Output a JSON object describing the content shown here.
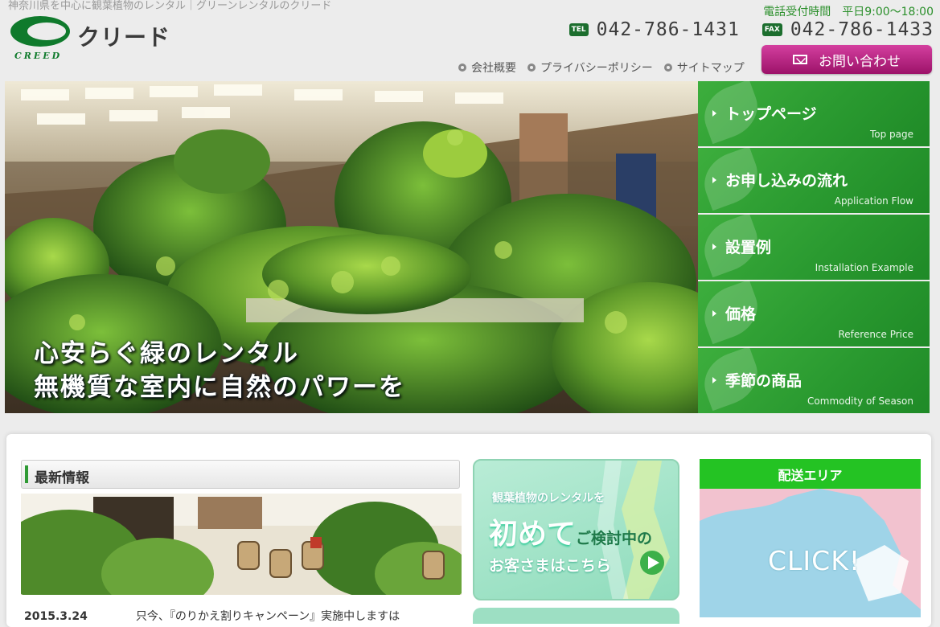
{
  "tagline": "神奈川県を中心に観葉植物のレンタル｜グリーンレンタルのクリード",
  "logo": {
    "jp": "クリード",
    "en": "CREED"
  },
  "contact": {
    "hours_label": "電話受付時間",
    "hours_value": "平日9:00〜18:00",
    "tel_tag": "TEL",
    "tel": "042-786-1431",
    "fax_tag": "FAX",
    "fax": "042-786-1433",
    "button": "お問い合わせ"
  },
  "toplinks": [
    "会社概要",
    "プライバシーポリシー",
    "サイトマップ"
  ],
  "hero": {
    "line1": "心安らぐ緑のレンタル",
    "line2": "無機質な室内に自然のパワーを"
  },
  "nav": [
    {
      "jp": "トップページ",
      "en": "Top page"
    },
    {
      "jp": "お申し込みの流れ",
      "en": "Application Flow"
    },
    {
      "jp": "設置例",
      "en": "Installation Example"
    },
    {
      "jp": "価格",
      "en": "Reference Price"
    },
    {
      "jp": "季節の商品",
      "en": "Commodity of Season"
    }
  ],
  "news": {
    "title": "最新情報",
    "date": "2015.3.24",
    "text": "只今、『のりかえ割りキャンペーン』実施中しますは"
  },
  "banner": {
    "line1": "観葉植物のレンタルを",
    "big": "初めて",
    "small": "ご検討中の",
    "line3": "お客さまはこちら"
  },
  "area": {
    "title": "配送エリア",
    "click": "CLICK!"
  },
  "colors": {
    "green": "#2a9a30",
    "magenta": "#b0207c",
    "area_green": "#24c323"
  }
}
